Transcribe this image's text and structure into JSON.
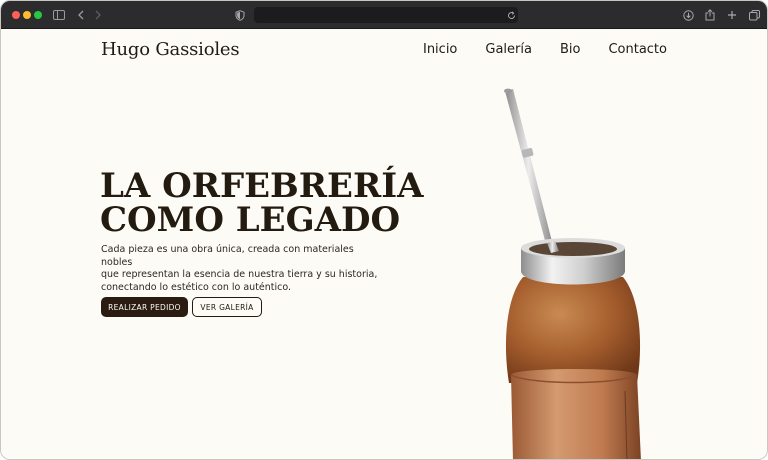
{
  "browser": {
    "icons": [
      "sidebar-icon",
      "back-icon",
      "forward-icon",
      "shield-icon",
      "reload-icon",
      "download-icon",
      "share-icon",
      "new-tab-icon",
      "tabs-overview-icon"
    ]
  },
  "header": {
    "logo": "Hugo Gassioles",
    "nav": [
      "Inicio",
      "Galería",
      "Bio",
      "Contacto"
    ]
  },
  "hero": {
    "title_line1": "LA ORFEBRERÍA",
    "title_line2": "COMO LEGADO",
    "text_line1": "Cada pieza es una obra única, creada con materiales nobles",
    "text_line2": "que representan la esencia de nuestra tierra y su historia,",
    "text_line3": "conectando lo estético con lo auténtico.",
    "primary_button": "REALIZAR PEDIDO",
    "secondary_button": "VER GALERÍA"
  },
  "colors": {
    "background": "#fdfbf6",
    "text": "#231a10",
    "primary_button": "#2a1c10"
  }
}
